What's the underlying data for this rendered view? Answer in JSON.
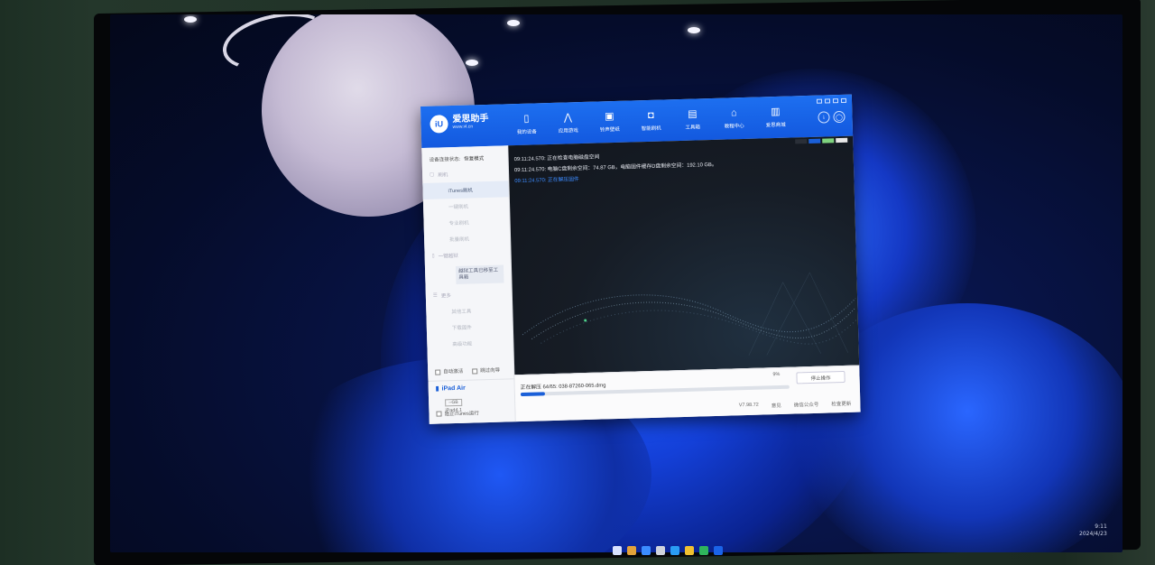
{
  "app": {
    "brand": {
      "logo": "iU",
      "name": "爱思助手",
      "url": "www.i4.cn"
    },
    "nav": [
      {
        "label": "我的设备",
        "icon": "phone-icon",
        "glyph": "▯"
      },
      {
        "label": "应用游戏",
        "icon": "app-store-icon",
        "glyph": "⋀"
      },
      {
        "label": "铃声壁纸",
        "icon": "wallpaper-icon",
        "glyph": "▣"
      },
      {
        "label": "智能刷机",
        "icon": "flash-icon",
        "glyph": "◘"
      },
      {
        "label": "工具箱",
        "icon": "toolbox-icon",
        "glyph": "▤"
      },
      {
        "label": "教程中心",
        "icon": "tutorial-icon",
        "glyph": "⌂"
      },
      {
        "label": "爱思商城",
        "icon": "store-icon",
        "glyph": "▥"
      }
    ],
    "top_buttons": {
      "download": "↓",
      "user": "◯"
    }
  },
  "sidebar": {
    "status_label": "设备连接状态:",
    "status_value": "恢复模式",
    "group_flash": "刷机",
    "flash_items": [
      "iTunes刷机",
      "一键刷机",
      "专业刷机",
      "批量刷机"
    ],
    "group_jailbreak": "一键越狱",
    "jailbreak_note": "越狱工具已移至工具箱",
    "group_more": "更多",
    "more_items": [
      "其他工具",
      "下载固件",
      "高级功能"
    ],
    "auto_activate": "自动激活",
    "skip_guide": "跳过向导",
    "device": {
      "name": "iPad Air",
      "capacity": "--GB",
      "model": "iPad4,1"
    },
    "block_itunes": "阻止iTunes运行"
  },
  "log": {
    "lines": [
      {
        "text": "09:11:24.570:  正在检查电脑磁盘空间",
        "highlight": false
      },
      {
        "text": "09:11:24.570:  电脑C盘剩余空间：74.87 GB，电脑固件缓存D盘剩余空间：192.10 GB。",
        "highlight": false
      },
      {
        "text": "09:11:24.570:  正在解压固件",
        "highlight": true
      }
    ],
    "mode_colors": [
      "#2a2f38",
      "#1a5fd8",
      "#7fd37f",
      "#e8e8e8"
    ]
  },
  "progress": {
    "text": "正在解压 64/65: 038-87260-065.dmg",
    "percent_label": "9%",
    "value": 0.09,
    "stop_label": "停止操作"
  },
  "footer": {
    "version": "V7.98.72",
    "feedback": "意见",
    "wechat": "微信公众号",
    "update": "检查更新"
  },
  "desktop": {
    "time": "9:11",
    "date": "2024/4/23"
  }
}
